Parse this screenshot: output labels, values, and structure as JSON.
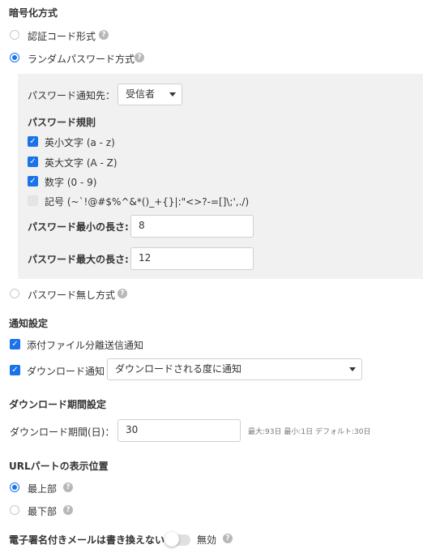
{
  "encryption": {
    "heading": "暗号化方式",
    "options": [
      {
        "label": "認証コード形式",
        "selected": false
      },
      {
        "label": "ランダムパスワード方式",
        "selected": true
      },
      {
        "label": "パスワード無し方式",
        "selected": false
      }
    ],
    "notify_target_label": "パスワード通知先：",
    "notify_target_value": "受信者",
    "rules_heading": "パスワード規則",
    "rules": [
      {
        "label": "英小文字 (a - z)",
        "checked": true
      },
      {
        "label": "英大文字 (A - Z)",
        "checked": true
      },
      {
        "label": "数字 (0 - 9)",
        "checked": true
      },
      {
        "label": "記号 (~`!@#$%^&*()_+{}|:\"<>?-=[]\\;',./)",
        "checked": false
      }
    ],
    "min_length_label": "パスワード最小の長さ:",
    "min_length_value": "8",
    "max_length_label": "パスワード最大の長さ:",
    "max_length_value": "12"
  },
  "notification": {
    "heading": "通知設定",
    "attachment_label": "添付ファイル分離送信通知",
    "attachment_checked": true,
    "download_label": "ダウンロード通知",
    "download_checked": true,
    "download_select_value": "ダウンロードされる度に通知"
  },
  "download_period": {
    "heading": "ダウンロード期間設定",
    "label": "ダウンロード期間(日)：",
    "value": "30",
    "hint": "最大:93日 最小:1日 デフォルト:30日"
  },
  "url_position": {
    "heading": "URLパートの表示位置",
    "options": [
      {
        "label": "最上部",
        "selected": true
      },
      {
        "label": "最下部",
        "selected": false
      }
    ]
  },
  "signature": {
    "label": "電子署名付きメールは書き換えない:",
    "toggle_on": false,
    "status": "無効"
  },
  "icons": {
    "help": "question-circle-icon",
    "check": "check-icon",
    "caret": "caret-down-icon"
  },
  "colors": {
    "accent": "#1a73e8",
    "panel_bg": "#f1f1f1",
    "help_icon": "#b8b8b8"
  }
}
